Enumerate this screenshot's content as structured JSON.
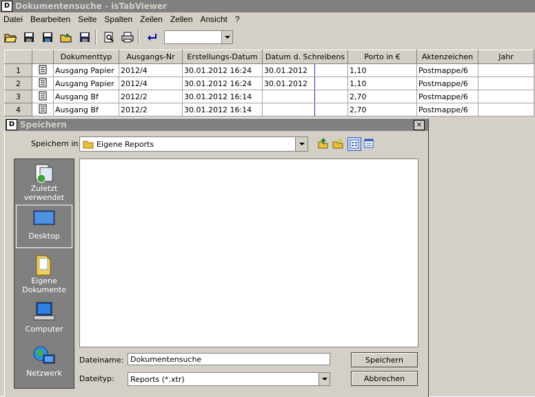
{
  "window": {
    "title": "Dokumentensuche - isTabViewer"
  },
  "menu": [
    "Datei",
    "Bearbeiten",
    "Seite",
    "Spalten",
    "Zeilen",
    "Zellen",
    "Ansicht",
    "?"
  ],
  "toolbar": {
    "combo_value": ""
  },
  "grid": {
    "columns": [
      "",
      "",
      "Dokumenttyp",
      "Ausgangs-Nr",
      "Erstellungs-Datum",
      "Datum d. Schreibens",
      "",
      "Porto in €",
      "Aktenzeichen",
      "Jahr"
    ],
    "rows": [
      {
        "num": "1",
        "typ": "Ausgang Papier",
        "nr": "2012/4",
        "erst": "30.01.2012 16:24",
        "datum": "30.01.2012",
        "extra": "",
        "porto": "1,10",
        "akten": "Postmappe/6",
        "jahr": ""
      },
      {
        "num": "2",
        "typ": "Ausgang Papier",
        "nr": "2012/4",
        "erst": "30.01.2012 16:24",
        "datum": "30.01.2012",
        "extra": "",
        "porto": "1,10",
        "akten": "Postmappe/6",
        "jahr": ""
      },
      {
        "num": "3",
        "typ": "Ausgang Bf",
        "nr": "2012/2",
        "erst": "30.01.2012 16:14",
        "datum": "",
        "extra": "",
        "porto": "2,70",
        "akten": "Postmappe/6",
        "jahr": ""
      },
      {
        "num": "4",
        "typ": "Ausgang Bf",
        "nr": "2012/2",
        "erst": "30.01.2012 16:14",
        "datum": "",
        "extra": "",
        "porto": "2,70",
        "akten": "Postmappe/6",
        "jahr": ""
      }
    ]
  },
  "dialog": {
    "title": "Speichern",
    "close": "×",
    "lookin_label": "Speichern in:",
    "lookin_value": "Eigene Reports",
    "places": [
      {
        "line1": "Zuletzt",
        "line2": "verwendet"
      },
      {
        "line1": "Desktop",
        "line2": ""
      },
      {
        "line1": "Eigene",
        "line2": "Dokumente"
      },
      {
        "line1": "Computer",
        "line2": ""
      },
      {
        "line1": "Netzwerk",
        "line2": ""
      }
    ],
    "filename_label": "Dateiname:",
    "filename_value": "Dokumentensuche",
    "filetype_label": "Dateityp:",
    "filetype_value": "Reports (*.xtr)",
    "save_button": "Speichern",
    "cancel_button": "Abbrechen"
  },
  "colors": {
    "titlebar": "#808080",
    "face": "#d4d0c8",
    "places_bg": "#808080"
  }
}
